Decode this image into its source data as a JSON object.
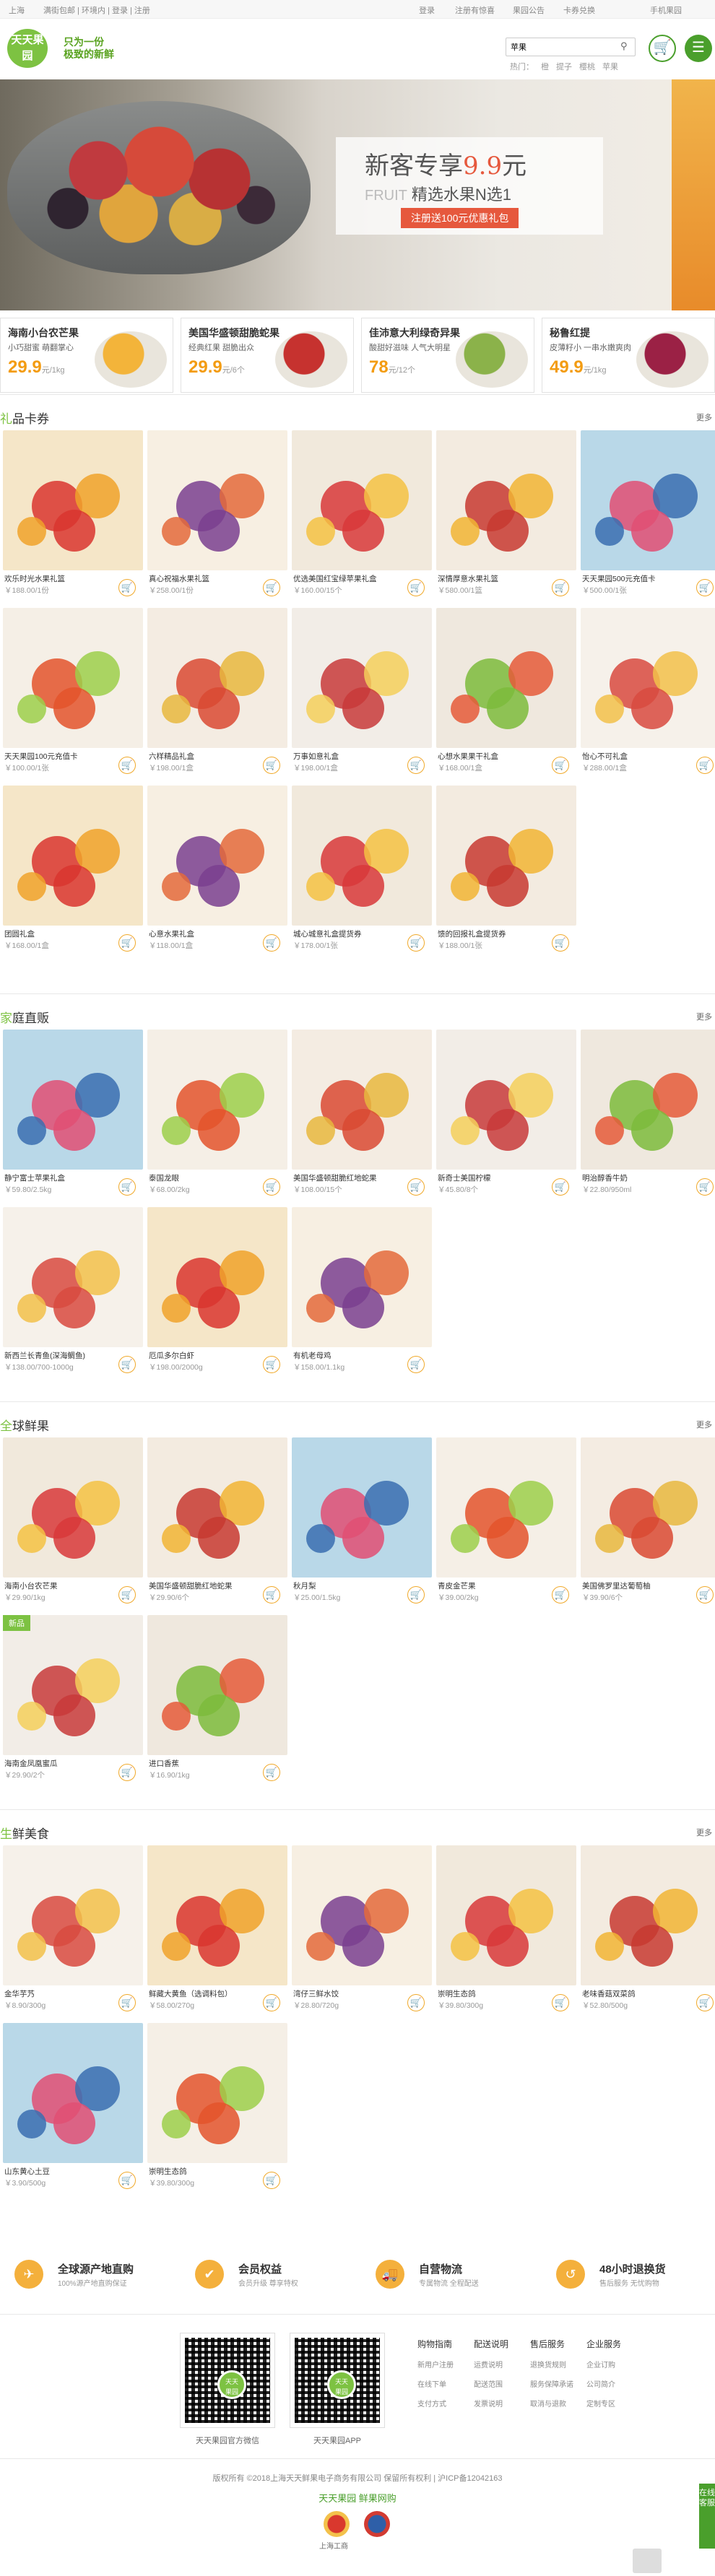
{
  "topbar": {
    "location": "上海",
    "login_prompt": "满街包邮 | 环境内 | 登录 | 注册",
    "links": [
      "登录",
      "注册有惊喜",
      "果园公告",
      "卡券兑换",
      "手机果园"
    ]
  },
  "header": {
    "logo": "天天果园",
    "slogan_line1": "只为一份",
    "slogan_line2": "极致的新鲜",
    "search_value": "苹果",
    "hot_label": "热门：",
    "hot_words": [
      "橙",
      "提子",
      "樱桃",
      "苹果"
    ]
  },
  "banner": {
    "title_prefix": "新客专享",
    "title_price": "9.9",
    "title_suffix": "元",
    "sub_en": "FRUIT",
    "sub_cn": "精选水果N选1",
    "cta": "注册送100元优惠礼包"
  },
  "promos": [
    {
      "title": "海南小台农芒果",
      "sub": "小巧甜蜜 萌翻掌心",
      "price": "29.9",
      "unit": "元/1kg"
    },
    {
      "title": "美国华盛顿甜脆蛇果",
      "sub": "经典红果 甜脆出众",
      "price": "29.9",
      "unit": "元/6个"
    },
    {
      "title": "佳沛意大利绿奇异果",
      "sub": "酸甜好滋味 人气大明星",
      "price": "78",
      "unit": "元/12个"
    },
    {
      "title": "秘鲁红提",
      "sub": "皮薄籽小 一串水嫩爽肉",
      "price": "49.9",
      "unit": "元/1kg"
    }
  ],
  "sections": [
    {
      "title_first": "礼",
      "title_rest": "品卡券",
      "more": "更多",
      "items": [
        {
          "name": "欢乐时光水果礼篮",
          "price": "￥188.00/1份"
        },
        {
          "name": "真心祝福水果礼篮",
          "price": "￥258.00/1份"
        },
        {
          "name": "优选美国红宝绿苹果礼盒",
          "price": "￥160.00/15个"
        },
        {
          "name": "深情厚意水果礼篮",
          "price": "￥580.00/1篮"
        },
        {
          "name": "天天果园500元充值卡",
          "price": "￥500.00/1张"
        },
        {
          "name": "天天果园100元充值卡",
          "price": "￥100.00/1张"
        },
        {
          "name": "六样精品礼盒",
          "price": "￥198.00/1盒"
        },
        {
          "name": "万事如意礼盒",
          "price": "￥198.00/1盒"
        },
        {
          "name": "心想水果果干礼盒",
          "price": "￥168.00/1盒"
        },
        {
          "name": "怡心不可礼盒",
          "price": "￥288.00/1盒"
        },
        {
          "name": "团圆礼盒",
          "price": "￥168.00/1盒"
        },
        {
          "name": "心意水果礼盒",
          "price": "￥118.00/1盒"
        },
        {
          "name": "城心城意礼盒提货券",
          "price": "￥178.00/1张"
        },
        {
          "name": "馈的回报礼盒提货券",
          "price": "￥188.00/1张"
        }
      ]
    },
    {
      "title_first": "家",
      "title_rest": "庭直贩",
      "more": "更多",
      "items": [
        {
          "name": "静宁富士苹果礼盒",
          "price": "￥59.80/2.5kg"
        },
        {
          "name": "泰国龙眼",
          "price": "￥68.00/2kg"
        },
        {
          "name": "美国华盛顿甜脆红地蛇果",
          "price": "￥108.00/15个"
        },
        {
          "name": "新奇士美国柠檬",
          "price": "￥45.80/8个"
        },
        {
          "name": "明治醇香牛奶",
          "price": "￥22.80/950ml"
        },
        {
          "name": "新西兰长青鱼(深海鲷鱼)",
          "price": "￥138.00/700-1000g"
        },
        {
          "name": "厄瓜多尔白虾",
          "price": "￥198.00/2000g"
        },
        {
          "name": "有机老母鸡",
          "price": "￥158.00/1.1kg"
        }
      ]
    },
    {
      "title_first": "全",
      "title_rest": "球鲜果",
      "more": "更多",
      "items": [
        {
          "name": "海南小台农芒果",
          "price": "￥29.90/1kg"
        },
        {
          "name": "美国华盛顿甜脆红地蛇果",
          "price": "￥29.90/6个"
        },
        {
          "name": "秋月梨",
          "price": "￥25.00/1.5kg"
        },
        {
          "name": "青皮金芒果",
          "price": "￥39.00/2kg"
        },
        {
          "name": "美国佛罗里达葡萄柚",
          "price": "￥39.90/6个"
        },
        {
          "name": "海南金凤凰蜜瓜",
          "price": "￥29.90/2个",
          "badge": "新品"
        },
        {
          "name": "进口香蕉",
          "price": "￥16.90/1kg"
        }
      ]
    },
    {
      "title_first": "生",
      "title_rest": "鲜美食",
      "more": "更多",
      "items": [
        {
          "name": "金华芋艿",
          "price": "￥8.90/300g"
        },
        {
          "name": "鲜藏大黄鱼（选调料包）",
          "price": "￥58.00/270g"
        },
        {
          "name": "湾仔三鲜水饺",
          "price": "￥28.80/720g"
        },
        {
          "name": "崇明生态鸽",
          "price": "￥39.80/300g"
        },
        {
          "name": "老味香菇双菜鸽",
          "price": "￥52.80/500g"
        },
        {
          "name": "山东黄心土豆",
          "price": "￥3.90/500g"
        },
        {
          "name": "崇明生态鸽",
          "price": "￥39.80/300g"
        }
      ]
    }
  ],
  "features": [
    {
      "title": "全球源产地直购",
      "sub": "100%源产地直购保证"
    },
    {
      "title": "会员权益",
      "sub": "会员升级 尊享特权"
    },
    {
      "title": "自营物流",
      "sub": "专属物流 全程配送"
    },
    {
      "title": "48小时退换货",
      "sub": "售后服务 无忧购物"
    }
  ],
  "qr": [
    {
      "label": "天天果园官方微信"
    },
    {
      "label": "天天果园APP"
    }
  ],
  "footer_cols": [
    {
      "head": "购物指南",
      "links": [
        "新用户注册",
        "在线下单",
        "支付方式"
      ]
    },
    {
      "head": "配送说明",
      "links": [
        "运费说明",
        "配送范围",
        "发票说明"
      ]
    },
    {
      "head": "售后服务",
      "links": [
        "退换货规则",
        "服务保障承诺",
        "取消与退款"
      ]
    },
    {
      "head": "企业服务",
      "links": [
        "企业订购",
        "公司简介",
        "定制专区"
      ]
    }
  ],
  "copyright": "版权所有 ©2018上海天天鲜果电子商务有限公司 保留所有权利 | 沪ICP备12042163",
  "footer_brand": "天天果园  鲜果网购",
  "gov_labels": [
    "上海工商",
    ""
  ],
  "float_label": "在线客服"
}
